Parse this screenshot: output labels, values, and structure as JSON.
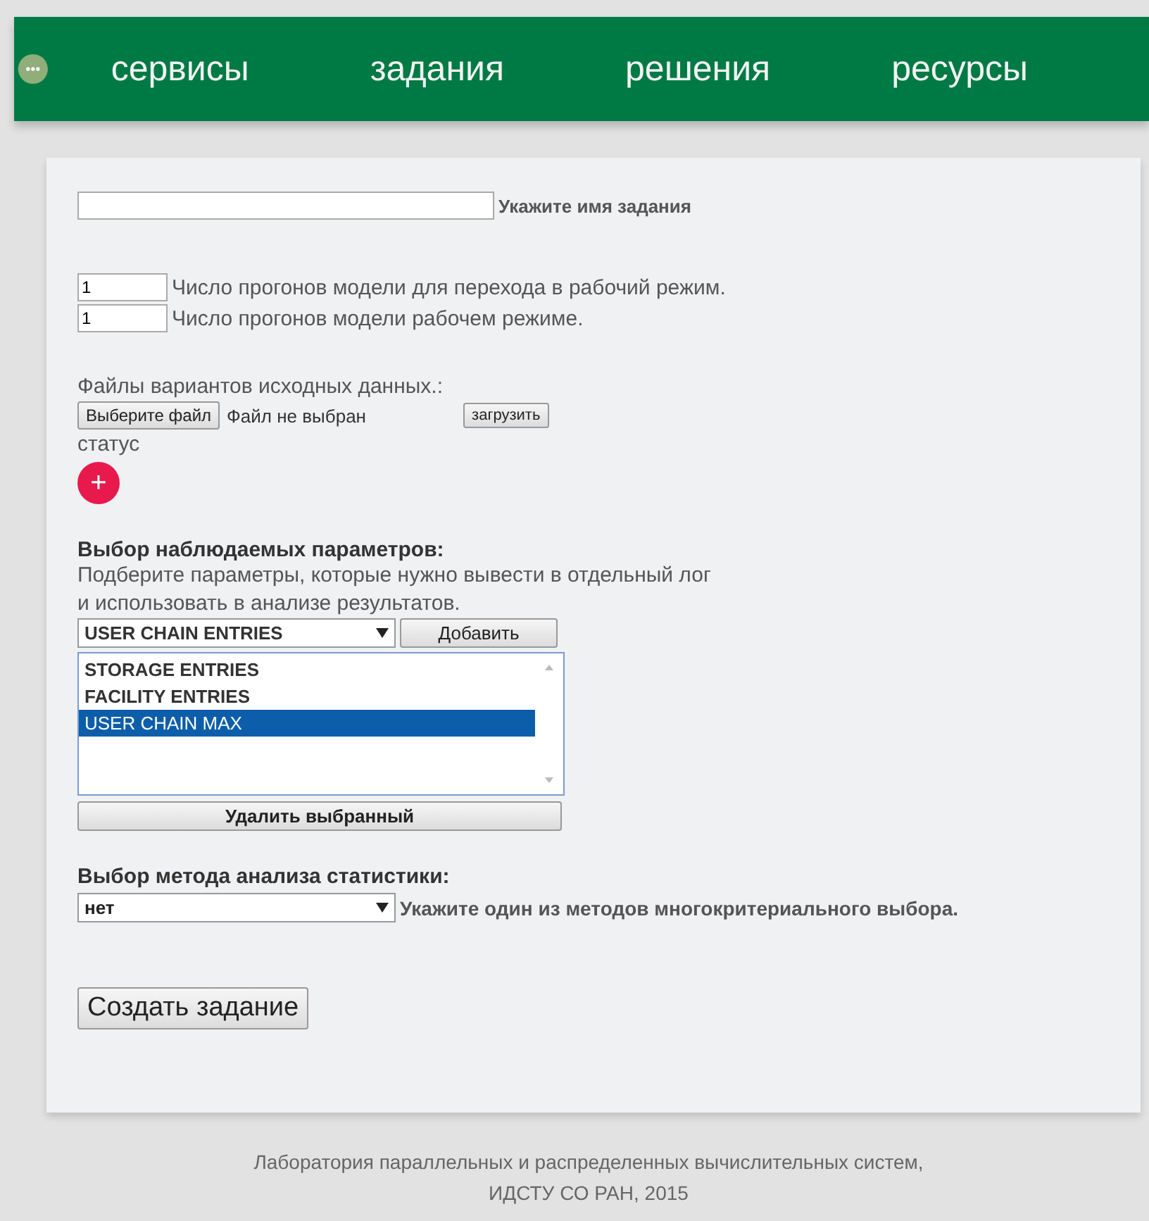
{
  "nav": {
    "items": [
      {
        "label": "сервисы"
      },
      {
        "label": "задания"
      },
      {
        "label": "решения"
      },
      {
        "label": "ресурсы"
      }
    ]
  },
  "task_name": {
    "label": "Укажите имя задания"
  },
  "runs": [
    {
      "value": "1",
      "label": "Число прогонов модели для перехода в рабочий режим."
    },
    {
      "value": "1",
      "label": "Число прогонов модели рабочем режиме."
    }
  ],
  "files": {
    "title": "Файлы вариантов исходных данных.:",
    "choose_button": "Выберите файл",
    "file_status": "Файл не выбран",
    "upload_button": "загрузить",
    "status_label": "статус",
    "add_symbol": "+"
  },
  "params": {
    "title": "Выбор наблюдаемых параметров:",
    "hint": "Подберите параметры, которые нужно вывести в отдельный лог\nи использовать в анализе результатов.",
    "select_value": "USER CHAIN ENTRIES",
    "add_button": "Добавить",
    "list": [
      {
        "label": "STORAGE ENTRIES",
        "selected": false
      },
      {
        "label": "FACILITY ENTRIES",
        "selected": false
      },
      {
        "label": "USER CHAIN MAX",
        "selected": true
      }
    ],
    "remove_button": "Удалить выбранный"
  },
  "method": {
    "title": "Выбор метода анализа статистики:",
    "select_value": "нет",
    "hint": "Укажите один из методов многокритериального выбора."
  },
  "create_button": "Создать задание",
  "footer": [
    "Лаборатория параллельных и распределенных вычислительных систем,",
    "ИДСТУ СО РАН, 2015"
  ]
}
